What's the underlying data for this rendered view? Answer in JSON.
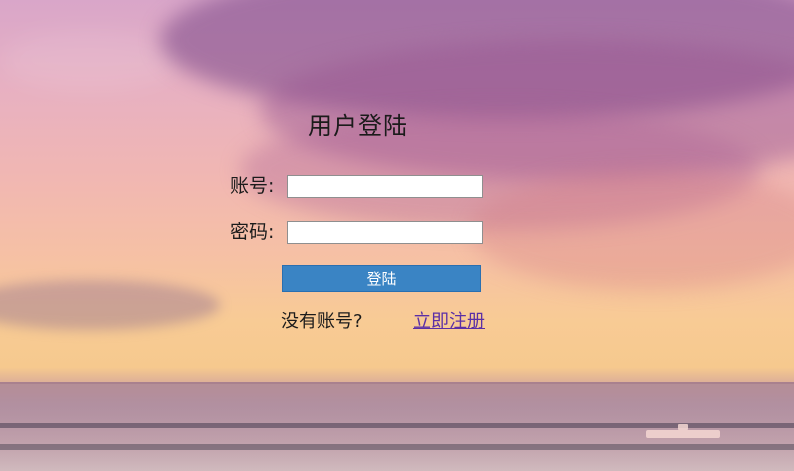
{
  "login": {
    "title": "用户登陆",
    "account_label": "账号:",
    "password_label": "密码:",
    "account_value": "",
    "password_value": "",
    "login_button": "登陆",
    "no_account_text": "没有账号?",
    "register_link": "立即注册"
  },
  "colors": {
    "button_bg": "#3a84c4",
    "button_text": "#ffffff",
    "link": "#5b2fa6",
    "text": "#1b1b1b"
  }
}
